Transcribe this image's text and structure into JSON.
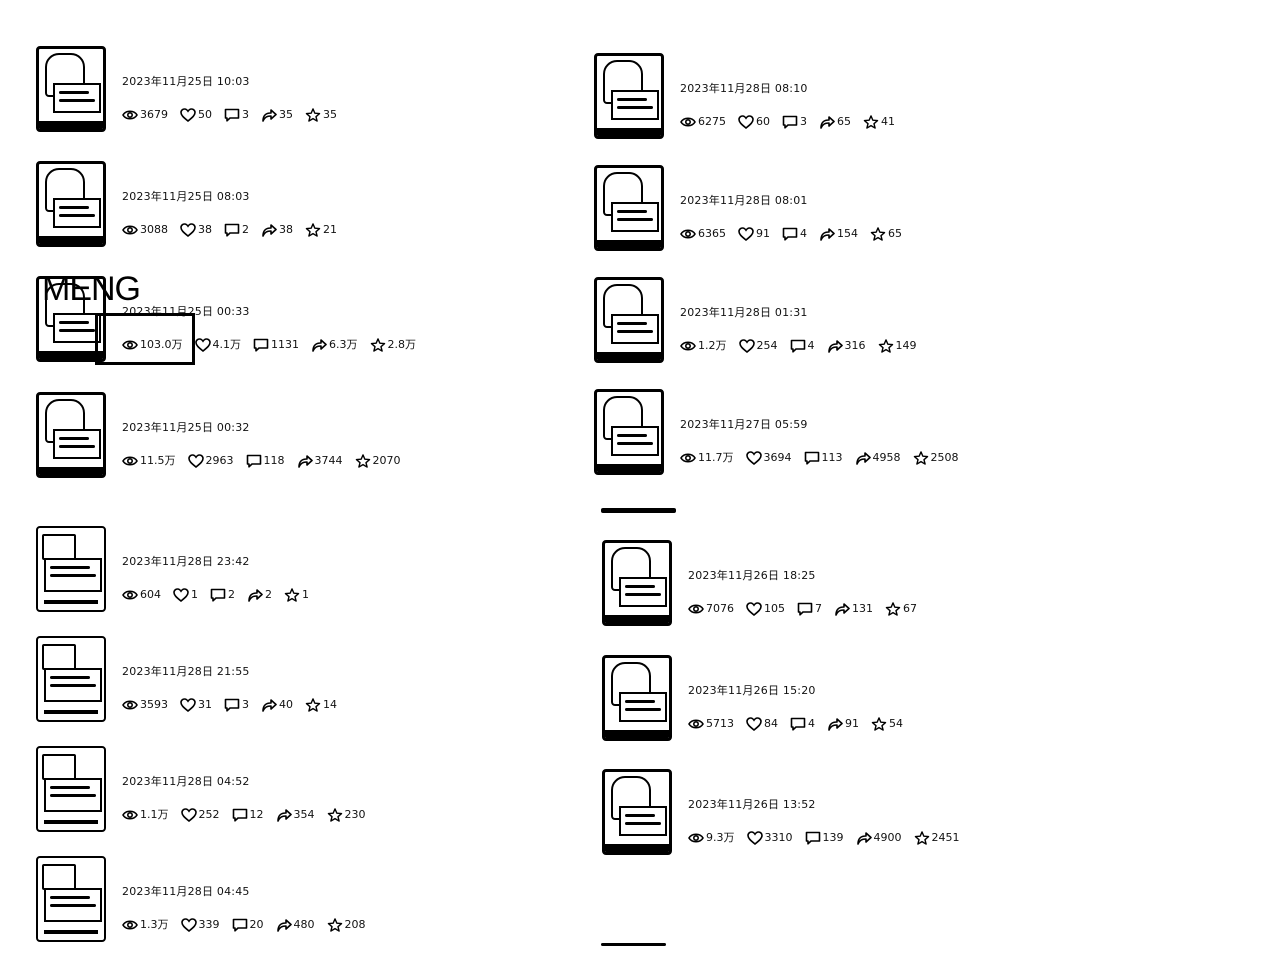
{
  "watermark": "MENG",
  "left_column_a": [
    {
      "date": "2023年11月25日 10:03",
      "views": "3679",
      "likes": "50",
      "comments": "3",
      "shares": "35",
      "favs": "35"
    },
    {
      "date": "2023年11月25日 08:03",
      "views": "3088",
      "likes": "38",
      "comments": "2",
      "shares": "38",
      "favs": "21"
    },
    {
      "date": "2023年11月25日 00:33",
      "views": "103.0万",
      "likes": "4.1万",
      "comments": "1131",
      "shares": "6.3万",
      "favs": "2.8万"
    },
    {
      "date": "2023年11月25日 00:32",
      "views": "11.5万",
      "likes": "2963",
      "comments": "118",
      "shares": "3744",
      "favs": "2070"
    }
  ],
  "left_column_b": [
    {
      "date": "2023年11月28日 23:42",
      "views": "604",
      "likes": "1",
      "comments": "2",
      "shares": "2",
      "favs": "1"
    },
    {
      "date": "2023年11月28日 21:55",
      "views": "3593",
      "likes": "31",
      "comments": "3",
      "shares": "40",
      "favs": "14"
    },
    {
      "date": "2023年11月28日 04:52",
      "views": "1.1万",
      "likes": "252",
      "comments": "12",
      "shares": "354",
      "favs": "230"
    },
    {
      "date": "2023年11月28日 04:45",
      "views": "1.3万",
      "likes": "339",
      "comments": "20",
      "shares": "480",
      "favs": "208"
    }
  ],
  "right_column_a": [
    {
      "date": "2023年11月28日 08:10",
      "views": "6275",
      "likes": "60",
      "comments": "3",
      "shares": "65",
      "favs": "41"
    },
    {
      "date": "2023年11月28日 08:01",
      "views": "6365",
      "likes": "91",
      "comments": "4",
      "shares": "154",
      "favs": "65"
    },
    {
      "date": "2023年11月28日 01:31",
      "views": "1.2万",
      "likes": "254",
      "comments": "4",
      "shares": "316",
      "favs": "149"
    },
    {
      "date": "2023年11月27日 05:59",
      "views": "11.7万",
      "likes": "3694",
      "comments": "113",
      "shares": "4958",
      "favs": "2508"
    }
  ],
  "right_column_b": [
    {
      "date": "2023年11月26日 18:25",
      "views": "7076",
      "likes": "105",
      "comments": "7",
      "shares": "131",
      "favs": "67"
    },
    {
      "date": "2023年11月26日 15:20",
      "views": "5713",
      "likes": "84",
      "comments": "4",
      "shares": "91",
      "favs": "54"
    },
    {
      "date": "2023年11月26日 13:52",
      "views": "9.3万",
      "likes": "3310",
      "comments": "139",
      "shares": "4900",
      "favs": "2451"
    }
  ],
  "icons": {
    "views": "eye-icon",
    "likes": "heart-icon",
    "comments": "comment-icon",
    "shares": "share-icon",
    "favs": "star-icon"
  }
}
